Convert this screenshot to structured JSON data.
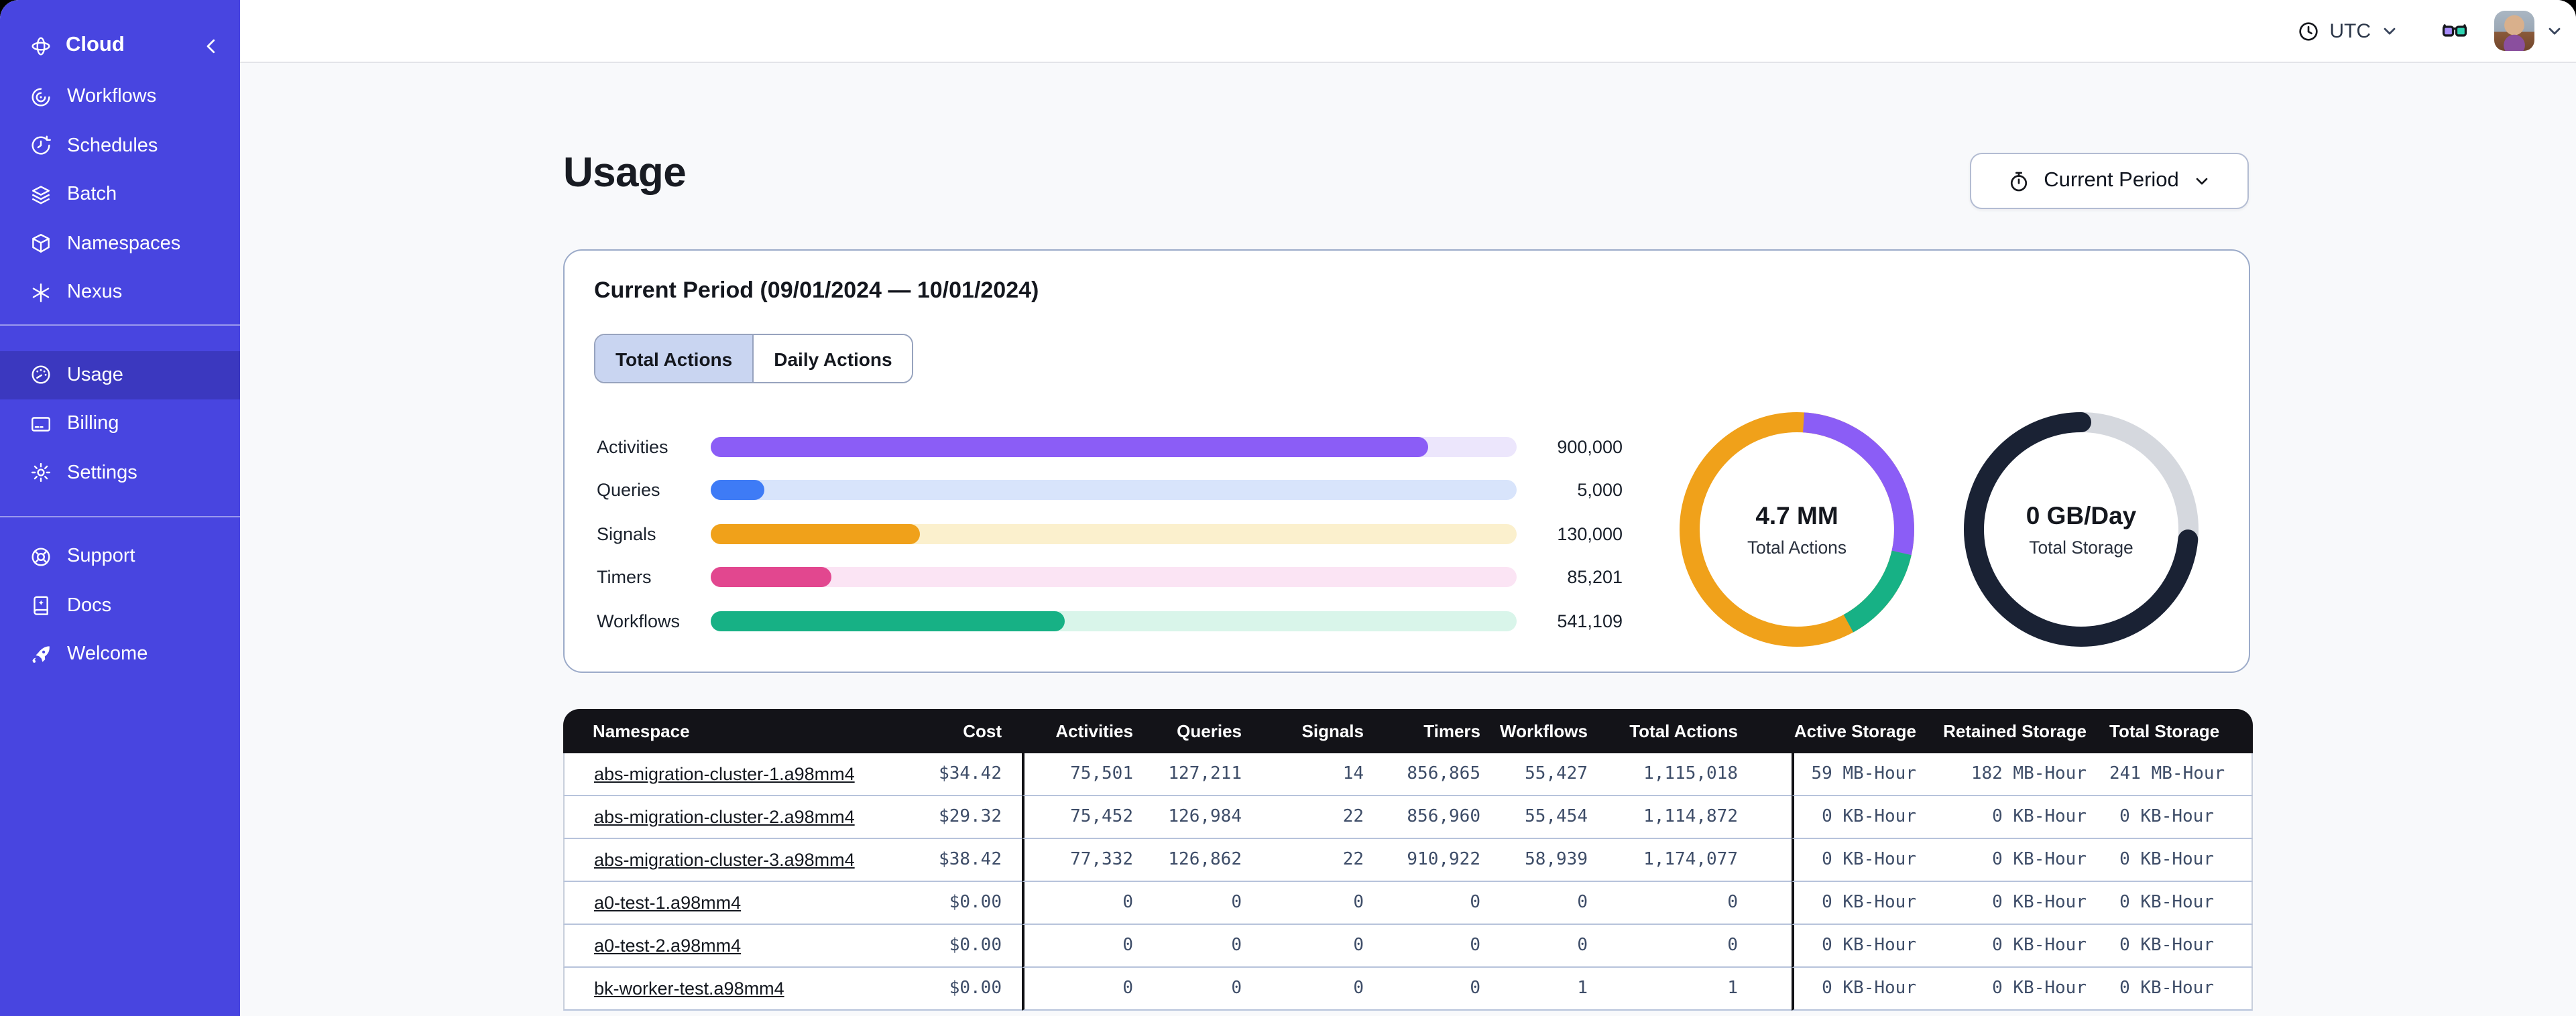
{
  "topbar": {
    "timezone": "UTC"
  },
  "sidebar": {
    "brand": {
      "label": "Cloud",
      "icon": "temporal-logo"
    },
    "sections": [
      {
        "name": "main",
        "items": [
          {
            "label": "Workflows",
            "icon": "workflows-icon",
            "active": false
          },
          {
            "label": "Schedules",
            "icon": "schedules-icon",
            "active": false
          },
          {
            "label": "Batch",
            "icon": "batch-icon",
            "active": false
          },
          {
            "label": "Namespaces",
            "icon": "namespaces-icon",
            "active": false
          },
          {
            "label": "Nexus",
            "icon": "nexus-icon",
            "active": false
          }
        ]
      },
      {
        "name": "account",
        "items": [
          {
            "label": "Usage",
            "icon": "usage-icon",
            "active": true
          },
          {
            "label": "Billing",
            "icon": "billing-icon",
            "active": false
          },
          {
            "label": "Settings",
            "icon": "settings-icon",
            "active": false
          }
        ]
      },
      {
        "name": "footer",
        "items": [
          {
            "label": "Support",
            "icon": "support-icon",
            "active": false
          },
          {
            "label": "Docs",
            "icon": "docs-icon",
            "active": false
          },
          {
            "label": "Welcome",
            "icon": "welcome-icon",
            "active": false
          }
        ]
      }
    ]
  },
  "page": {
    "title": "Usage",
    "period_button_label": "Current Period"
  },
  "usage_card": {
    "title": "Current Period (09/01/2024 — 10/01/2024)",
    "tabs": [
      {
        "label": "Total Actions",
        "active": true
      },
      {
        "label": "Daily Actions",
        "active": false
      }
    ]
  },
  "chart_data": [
    {
      "type": "bar",
      "title": "Usage by action type (current period)",
      "orientation": "horizontal",
      "categories": [
        "Activities",
        "Queries",
        "Signals",
        "Timers",
        "Workflows"
      ],
      "values": [
        900000,
        5000,
        130000,
        85201,
        541109
      ],
      "value_labels": [
        "900,000",
        "5,000",
        "130,000",
        "85,201",
        "541,109"
      ],
      "fill_percent": [
        89,
        6.6,
        26,
        15,
        44
      ],
      "bar_colors": [
        "#8B5DF6",
        "#3E7BF6",
        "#F0A11A",
        "#E2478F",
        "#17B185"
      ],
      "track_colors": [
        "#ECE6FC",
        "#D8E4FB",
        "#FBF0CD",
        "#FBE4F4",
        "#D9F5EA"
      ]
    },
    {
      "type": "pie",
      "title": "Total Actions donut",
      "center_value": "4.7 MM",
      "center_label": "Total Actions",
      "base_color": "#F0A11A",
      "segments": [
        {
          "name": "purple",
          "color": "#8B5DF6",
          "start_percent": 1,
          "percent": 27.5
        },
        {
          "name": "green",
          "color": "#17B185",
          "start_percent": 28.5,
          "percent": 13.5
        },
        {
          "name": "orange-base",
          "color": "#F0A11A",
          "start_percent": 42,
          "percent": 58
        }
      ]
    },
    {
      "type": "pie",
      "title": "Total Storage donut",
      "center_value": "0 GB/Day",
      "center_label": "Total Storage",
      "base_color": "#D5D8DE",
      "segments": [
        {
          "name": "dark",
          "color": "#1A2234",
          "start_percent": 26.5,
          "percent": 75,
          "round_cap": true
        },
        {
          "name": "gray-base",
          "color": "#D5D8DE",
          "start_percent": 1.5,
          "percent": 25
        }
      ]
    }
  ],
  "table": {
    "columns": [
      "Namespace",
      "Cost",
      "Activities",
      "Queries",
      "Signals",
      "Timers",
      "Workflows",
      "Total Actions",
      "Active Storage",
      "Retained Storage",
      "Total Storage"
    ],
    "rows": [
      [
        "abs-migration-cluster-1.a98mm4",
        "$34.42",
        "75,501",
        "127,211",
        "14",
        "856,865",
        "55,427",
        "1,115,018",
        "59 MB-Hour",
        "182 MB-Hour",
        "241 MB-Hour"
      ],
      [
        "abs-migration-cluster-2.a98mm4",
        "$29.32",
        "75,452",
        "126,984",
        "22",
        "856,960",
        "55,454",
        "1,114,872",
        "0 KB-Hour",
        "0 KB-Hour",
        "0 KB-Hour"
      ],
      [
        "abs-migration-cluster-3.a98mm4",
        "$38.42",
        "77,332",
        "126,862",
        "22",
        "910,922",
        "58,939",
        "1,174,077",
        "0 KB-Hour",
        "0 KB-Hour",
        "0 KB-Hour"
      ],
      [
        "a0-test-1.a98mm4",
        "$0.00",
        "0",
        "0",
        "0",
        "0",
        "0",
        "0",
        "0 KB-Hour",
        "0 KB-Hour",
        "0 KB-Hour"
      ],
      [
        "a0-test-2.a98mm4",
        "$0.00",
        "0",
        "0",
        "0",
        "0",
        "0",
        "0",
        "0 KB-Hour",
        "0 KB-Hour",
        "0 KB-Hour"
      ],
      [
        "bk-worker-test.a98mm4",
        "$0.00",
        "0",
        "0",
        "0",
        "0",
        "1",
        "1",
        "0 KB-Hour",
        "0 KB-Hour",
        "0 KB-Hour"
      ]
    ]
  }
}
